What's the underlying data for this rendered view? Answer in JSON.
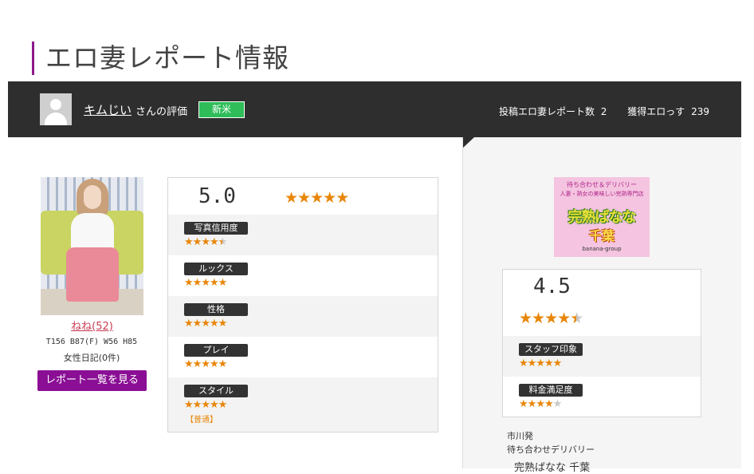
{
  "page": {
    "title": "エロ妻レポート情報"
  },
  "reviewer": {
    "name": "キムじい",
    "suffix": "さんの評価",
    "rank": "新米",
    "report_count_label": "投稿エロ妻レポート数",
    "report_count": "2",
    "points_label": "獲得エロっす",
    "points": "239"
  },
  "girl": {
    "name": "ねね(52)",
    "measurements": "T156 B87(F) W56 H85",
    "diary": "女性日記(0件)",
    "report_list_button": "レポート一覧を見る"
  },
  "girl_rating": {
    "overall": "5.0",
    "overall_stars": 5,
    "items": [
      {
        "label": "写真信用度",
        "stars": 4.5
      },
      {
        "label": "ルックス",
        "stars": 5
      },
      {
        "label": "性格",
        "stars": 5
      },
      {
        "label": "プレイ",
        "stars": 5
      },
      {
        "label": "スタイル",
        "stars": 5,
        "note": "【普通】"
      }
    ]
  },
  "shop": {
    "logo": {
      "line1": "待ち合わせ＆デリバリー",
      "line2": "人妻・熟女の美味しい完熟専門店",
      "title": "完熟ばなな",
      "subtitle": "千葉",
      "url": "banana-group"
    },
    "overall": "4.5",
    "overall_stars": 4.5,
    "items": [
      {
        "label": "スタッフ印象",
        "stars": 5
      },
      {
        "label": "料金満足度",
        "stars": 4
      }
    ],
    "area": "市川発",
    "type": "待ち合わせデリバリー",
    "name": "完熟ばなな 千葉"
  },
  "colors": {
    "accent_purple": "#8a0f95",
    "star": "#e8860a",
    "badge_green": "#2ebd59",
    "dark_bar": "#2e2e2e"
  }
}
